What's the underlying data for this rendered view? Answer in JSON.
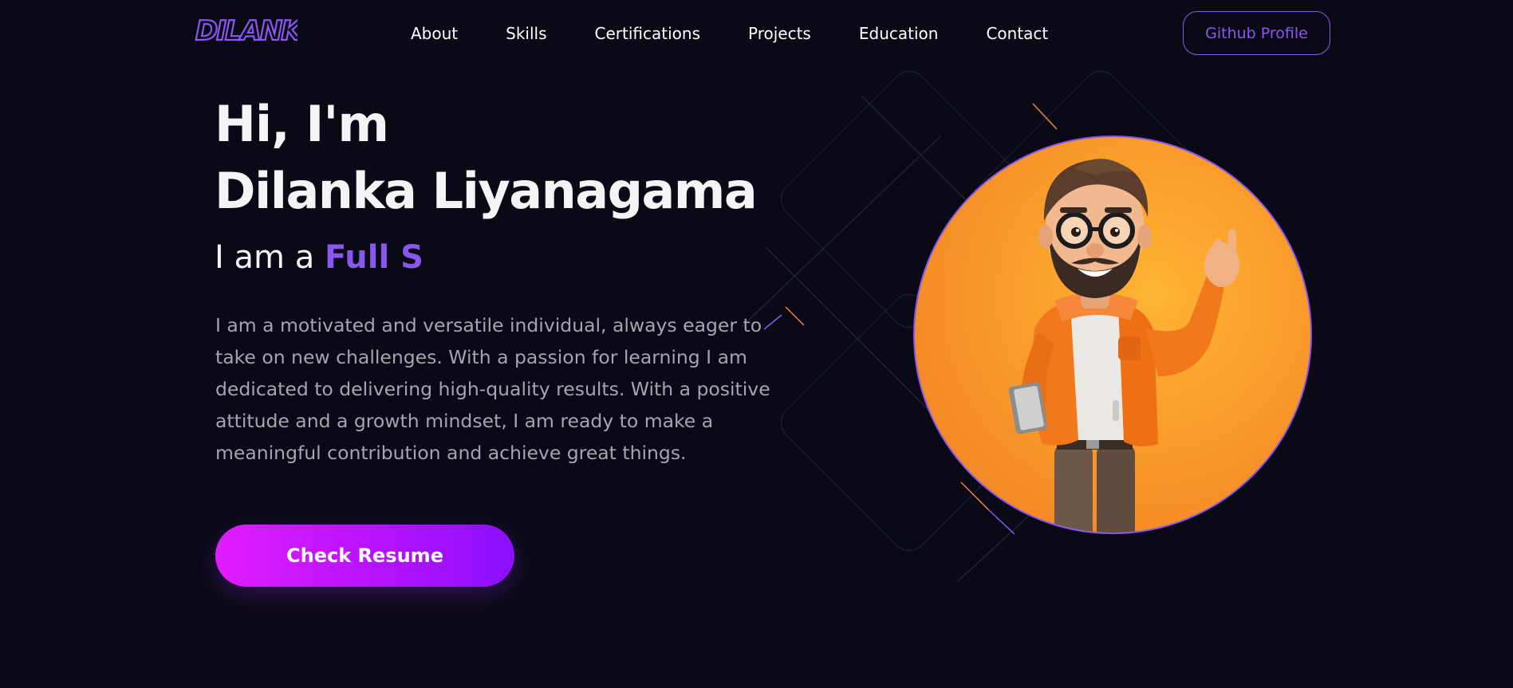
{
  "brand": {
    "logo_text": "DILANKA",
    "accent": "#8a56f0",
    "background": "#0a0a16"
  },
  "nav": {
    "items": [
      {
        "label": "About"
      },
      {
        "label": "Skills"
      },
      {
        "label": "Certifications"
      },
      {
        "label": "Projects"
      },
      {
        "label": "Education"
      },
      {
        "label": "Contact"
      }
    ],
    "github_label": "Github Profile"
  },
  "hero": {
    "greeting": "Hi, I'm",
    "name": "Dilanka Liyanagama",
    "role_prefix": "I am a",
    "role_typed": "Full S",
    "bio": "I am a motivated and versatile individual, always eager to take on new challenges. With a passion for learning I am dedicated to delivering high-quality results. With a positive attitude and a growth mindset, I am ready to make a meaningful contribution and achieve great things.",
    "cta_label": "Check Resume",
    "cta_gradient": [
      "#e11dff",
      "#8a10ff"
    ],
    "avatar_icon": "developer-avatar-illustration",
    "avatar_bg": "#f99a2a"
  }
}
